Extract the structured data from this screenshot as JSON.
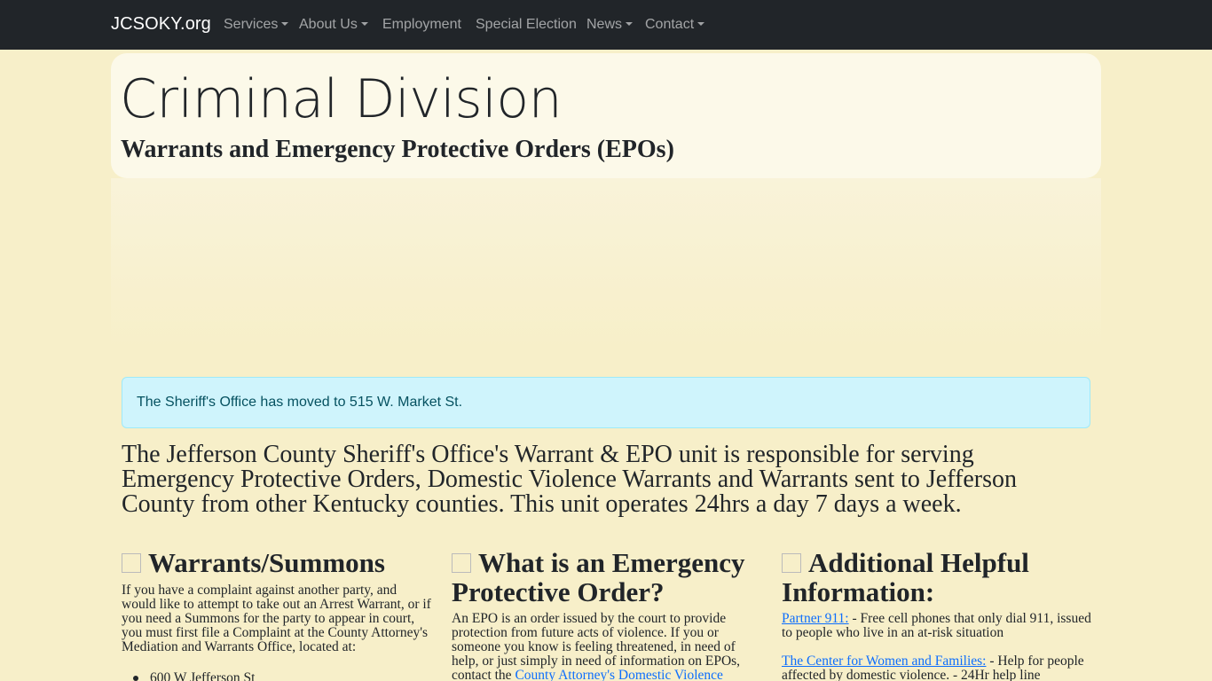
{
  "navbar": {
    "brand": "JCSOKY.org",
    "items": [
      {
        "label": "Services",
        "dropdown": true
      },
      {
        "label": "About Us",
        "dropdown": true
      },
      {
        "label": "Employment",
        "dropdown": false
      },
      {
        "label": "Special Election",
        "dropdown": false
      },
      {
        "label": "News",
        "dropdown": true
      },
      {
        "label": "Contact",
        "dropdown": true
      }
    ]
  },
  "header": {
    "title": "Criminal Division",
    "subtitle": "Warrants and Emergency Protective Orders (EPOs)"
  },
  "alert": {
    "text": "The Sheriff's Office has moved to 515 W. Market St."
  },
  "intro": "The Jefferson County Sheriff's Office's Warrant & EPO unit is responsible for serving Emergency Protective Orders, Domestic Violence Warrants and Warrants sent to Jefferson County from other Kentucky counties. This unit operates 24hrs a day 7 days a week.",
  "columns": {
    "warrants": {
      "icon": "document-icon",
      "heading": "Warrants/Summons",
      "text": "If you have a complaint against another party, and would like to attempt to take out an Arrest Warrant, or if you need a Summons for the party to appear in court, you must first file a Complaint at the County Attorney's Mediation and Warrants Office, located at:",
      "list_item": "600 W Jefferson St"
    },
    "epo": {
      "icon": "shield-icon",
      "heading": "What is an Emergency Protective Order?",
      "text": "An EPO is an order issued by the court to provide protection from future acts of violence. If you or someone you know is feeling threatened, in need of help, or just simply in need of information on EPOs, contact the",
      "link": "County Attorney's Domestic Violence"
    },
    "info": {
      "icon": "info-icon",
      "heading": "Additional Helpful Information:",
      "items": [
        {
          "link": "Partner 911:",
          "text": " - Free cell phones that only dial 911, issued to people who live in an at-risk situation"
        },
        {
          "link": "The Center for Women and Families:",
          "text": " - Help for people affected by domestic violence. - 24Hr help line"
        }
      ]
    }
  },
  "colors": {
    "navbar_bg": "#212529",
    "page_bg": "#f7efc9",
    "jumbotron_bg": "#fcf9e9",
    "alert_bg": "#cff4fc",
    "alert_text": "#055160",
    "link": "#0d6efd"
  }
}
